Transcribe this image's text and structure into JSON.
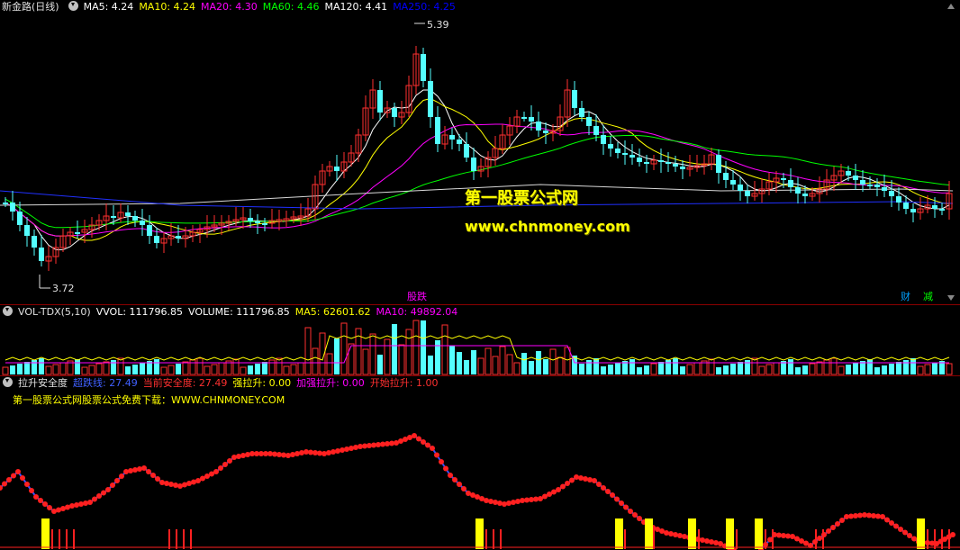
{
  "price_panel": {
    "title": "新金路(日线)",
    "indicators": [
      {
        "label": "MA5: 4.24",
        "color": "#ffffff"
      },
      {
        "label": "MA10: 4.24",
        "color": "#ffff00"
      },
      {
        "label": "MA20: 4.30",
        "color": "#ff00ff"
      },
      {
        "label": "MA60: 4.46",
        "color": "#00ff00"
      },
      {
        "label": "MA120: 4.41",
        "color": "#ffffff"
      },
      {
        "label": "MA250: 4.25",
        "color": "#0000ff"
      }
    ],
    "high_label": "5.39",
    "low_label": "3.72",
    "event_tags": [
      {
        "label": "股跌",
        "color": "#ff00ff"
      },
      {
        "label": "财",
        "color": "#00a0ff"
      },
      {
        "label": "减",
        "color": "#00ff00"
      }
    ],
    "watermark_line1": "第一股票公式网",
    "watermark_line2": "www.chnmoney.com"
  },
  "volume_panel": {
    "title": "VOL-TDX(5,10)",
    "indicators": [
      {
        "label": "VVOL: 111796.85",
        "color": "#ffffff"
      },
      {
        "label": "VOLUME: 111796.85",
        "color": "#ffffff"
      },
      {
        "label": "MA5: 62601.62",
        "color": "#ffff00"
      },
      {
        "label": "MA10: 49892.04",
        "color": "#ff00ff"
      }
    ]
  },
  "indicator_panel": {
    "title": "拉升安全度",
    "indicators": [
      {
        "label": "超跌线: 27.49",
        "color": "#4060ff"
      },
      {
        "label": "当前安全度: 27.49",
        "color": "#ff3030"
      },
      {
        "label": "强拉升: 0.00",
        "color": "#ffff00"
      },
      {
        "label": "加强拉升: 0.00",
        "color": "#ff00ff"
      },
      {
        "label": "开始拉升: 1.00",
        "color": "#ff3030"
      }
    ],
    "promo_text": "第一股票公式网股票公式免费下载：WWW.CHNMONEY.COM"
  },
  "colors": {
    "up": "#ff3030",
    "down": "#54ffff",
    "separator": "#8b0000",
    "background": "#000000"
  }
}
